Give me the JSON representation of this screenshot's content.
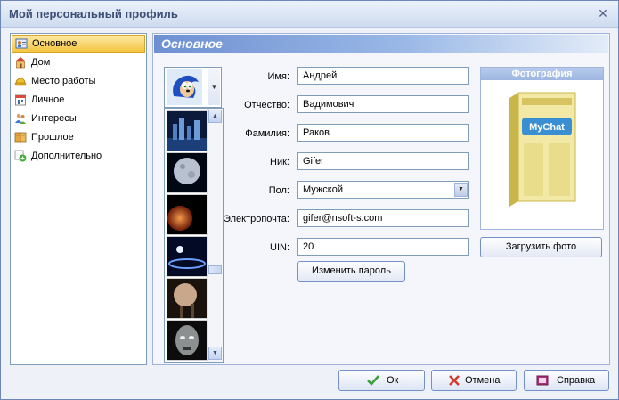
{
  "window": {
    "title": "Мой персональный профиль"
  },
  "nav": {
    "items": [
      {
        "label": "Основное",
        "icon": "person-card-icon",
        "selected": true
      },
      {
        "label": "Дом",
        "icon": "house-icon"
      },
      {
        "label": "Место работы",
        "icon": "helmet-icon"
      },
      {
        "label": "Личное",
        "icon": "calendar-icon"
      },
      {
        "label": "Интересы",
        "icon": "people-icon"
      },
      {
        "label": "Прошлое",
        "icon": "book-icon"
      },
      {
        "label": "Дополнительно",
        "icon": "plus-icon"
      }
    ]
  },
  "panel": {
    "title": "Основное"
  },
  "form": {
    "name_label": "Имя:",
    "name_value": "Андрей",
    "patronymic_label": "Отчество:",
    "patronymic_value": "Вадимович",
    "surname_label": "Фамилия:",
    "surname_value": "Раков",
    "nick_label": "Ник:",
    "nick_value": "Gifer",
    "gender_label": "Пол:",
    "gender_value": "Мужской",
    "email_label": "Электропочта:",
    "email_value": "gifer@nsoft-s.com",
    "uin_label": "UIN:",
    "uin_value": "20",
    "change_password": "Изменить пароль"
  },
  "photo": {
    "caption": "Фотография",
    "upload_button": "Загрузить фото"
  },
  "footer": {
    "ok": "Ок",
    "cancel": "Отмена",
    "help": "Справка"
  },
  "colors": {
    "accent": "#f6c543",
    "header_blue": "#6e90d2",
    "border": "#7f9db9"
  }
}
